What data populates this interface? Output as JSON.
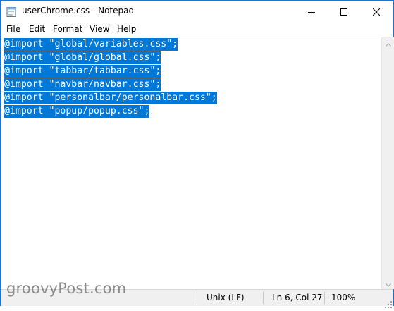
{
  "window": {
    "title": "userChrome.css - Notepad",
    "controls": {
      "minimize_icon": "minimize-icon",
      "maximize_icon": "maximize-icon",
      "close_icon": "close-icon"
    },
    "accent": "#0078d7"
  },
  "menu": {
    "items": [
      {
        "label": "File"
      },
      {
        "label": "Edit"
      },
      {
        "label": "Format"
      },
      {
        "label": "View"
      },
      {
        "label": "Help"
      }
    ]
  },
  "editor": {
    "lines": [
      "@import \"global/variables.css\";",
      "@import \"global/global.css\";",
      "@import \"tabbar/tabbar.css\";",
      "@import \"navbar/navbar.css\";",
      "@import \"personalbar/personalbar.css\";",
      "@import \"popup/popup.css\";"
    ],
    "selection": "all text selected"
  },
  "status": {
    "line_ending": "Unix (LF)",
    "position": "Ln 6, Col 27",
    "zoom": "100%"
  },
  "watermark": "groovyPost.com"
}
